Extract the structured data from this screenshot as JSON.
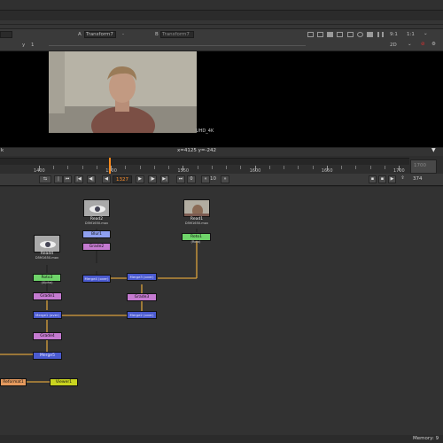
{
  "viewer": {
    "input_a_label": "A",
    "input_a_value": "Transform7",
    "input_a_dash": "-",
    "input_b_label": "B",
    "input_b_value": "Transform7",
    "channel_y": "y",
    "channel_val": "1",
    "right_frame": "9:1",
    "zoom": "1:1",
    "view_mode": "2D",
    "format_label": "UHD_4K",
    "coords": "x=4125 y=-242",
    "status_left": "k"
  },
  "timeline": {
    "ticks": [
      "1400",
      "1500",
      "1550",
      "1600",
      "1650",
      "1700"
    ],
    "end_frame": "1700",
    "current_frame": "1327",
    "step": "10",
    "fps": "374",
    "step_prefix": "0"
  },
  "transport_icons": [
    "frame-range-icon",
    "first-frame-icon",
    "prev-keyframe-icon",
    "prev-frame-icon",
    "play-backward-icon",
    "play-forward-icon",
    "next-frame-icon",
    "next-keyframe-icon",
    "last-frame-icon",
    "skip-back-icon",
    "skip-forward-icon"
  ],
  "nodes": {
    "read2": {
      "label": "Read2",
      "sub": "D5M1650.mov"
    },
    "read1": {
      "label": "Read1",
      "sub": "D5M1650.mov"
    },
    "read4": {
      "label": "Read4",
      "sub": "D5M1650.mov"
    },
    "blur1": "Blur1",
    "grade_a": "Grade2",
    "roto1": "Roto1",
    "roto1_sub": "(Roto)",
    "roto3": "Roto3",
    "roto3_sub": "(Alpha)",
    "merge_a": "Merge4 (over)",
    "merge_b": "Merge3 (over)",
    "grade_b": "Grade3",
    "merge_c": "Merge1 (over)",
    "merge_d": "Merge2 (over)",
    "grade_c": "Grade1",
    "grade_d": "Grade4",
    "merge_e": "Merge5",
    "reformat": "Reformat1",
    "viewer": "Viewer1"
  },
  "memory": "Memory: 9",
  "colors": {
    "playhead": "#ff8a1c",
    "merge": "#4b5bd0",
    "grade": "#c47ad0",
    "roto": "#6fd46a",
    "reformat": "#e59a5e",
    "viewer": "#c9d420",
    "wire_orange": "#d9a03c"
  }
}
